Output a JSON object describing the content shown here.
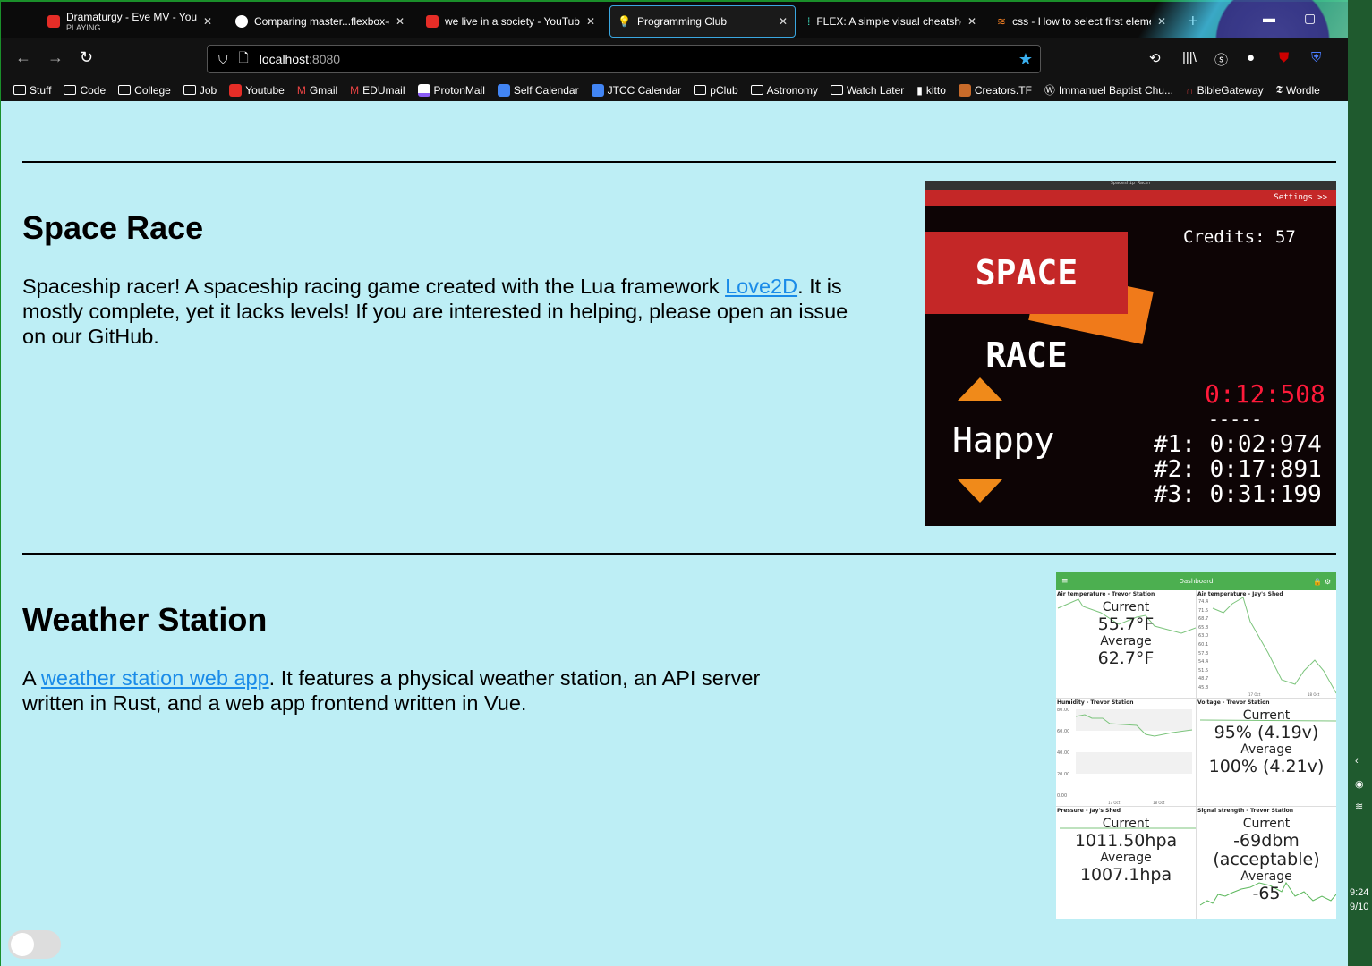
{
  "tabs": [
    {
      "title": "Dramaturgy - Eve MV - YouTube",
      "sub": "PLAYING",
      "icon": "youtube-icon"
    },
    {
      "title": "Comparing master...flexbox-clean",
      "icon": "github-icon"
    },
    {
      "title": "we live in a society - YouTube",
      "icon": "youtube-icon"
    },
    {
      "title": "Programming Club",
      "icon": "lightbulb-icon",
      "active": true
    },
    {
      "title": "FLEX: A simple visual cheatsheet",
      "icon": "flex-icon"
    },
    {
      "title": "css - How to select first element",
      "icon": "stackoverflow-icon"
    }
  ],
  "new_tab": "+",
  "url": {
    "host": "localhost",
    "port": ":8080"
  },
  "bookmarks": [
    "Stuff",
    "Code",
    "College",
    "Job",
    "Youtube",
    "Gmail",
    "EDUmail",
    "ProtonMail",
    "Self Calendar",
    "JTCC Calendar",
    "pClub",
    "Astronomy",
    "Watch Later",
    "kitto",
    "Creators.TF",
    "Immanuel Baptist Chu...",
    "BibleGateway",
    "Wordle"
  ],
  "projects": [
    {
      "title": "Space Race",
      "text_before": "Spaceship racer! A spaceship racing game created with the Lua framework ",
      "link": "Love2D",
      "text_after": ". It is mostly complete, yet it lacks levels! If you are interested in helping, please open an issue on our GitHub."
    },
    {
      "title": "Weather Station",
      "text_before": "A ",
      "link": "weather station web app",
      "text_after": ". It features a physical weather station, an API server written in Rust, and a web app frontend written in Vue."
    }
  ],
  "space_race": {
    "window_title": "Spaceship Racer",
    "settings": "Settings >>",
    "logo": "SPACE RACE",
    "credits": "Credits: 57",
    "timer": "0:12:508",
    "dashes": "-----",
    "mood": "Happy",
    "scores": [
      "#1: 0:02:974",
      "#2: 0:17:891",
      "#3: 0:31:199"
    ]
  },
  "weather": {
    "header": "Dashboard",
    "menu": "≡",
    "lock": "🔒",
    "gear": "⚙",
    "cards": [
      {
        "title": "Air temperature - Trevor Station",
        "current_label": "Current",
        "current": "55.7°F",
        "average_label": "Average",
        "average": "62.7°F"
      },
      {
        "title": "Air temperature - Jay's Shed",
        "ticks": [
          "74.4",
          "71.5",
          "68.7",
          "65.8",
          "63.0",
          "60.1",
          "57.3",
          "54.4",
          "51.5",
          "48.7",
          "45.8"
        ],
        "x": [
          "17 Oct",
          "18 Oct"
        ]
      },
      {
        "title": "Humidity - Trevor Station",
        "ticks": [
          "80.00",
          "60.00",
          "40.00",
          "20.00",
          "0.00"
        ],
        "x": [
          "17 Oct",
          "18 Oct"
        ]
      },
      {
        "title": "Voltage - Trevor Station",
        "current_label": "Current",
        "current": "95% (4.19v)",
        "average_label": "Average",
        "average": "100% (4.21v)"
      },
      {
        "title": "Pressure - Jay's Shed",
        "current_label": "Current",
        "current": "1011.50hpa",
        "average_label": "Average",
        "average": "1007.1hpa"
      },
      {
        "title": "Signal strength - Trevor Station",
        "current_label": "Current",
        "current": "-69dbm",
        "current2": "(acceptable)",
        "average_label": "Average",
        "average": "-65"
      }
    ]
  },
  "taskbar": {
    "time": "9:24",
    "date": "9/10"
  }
}
